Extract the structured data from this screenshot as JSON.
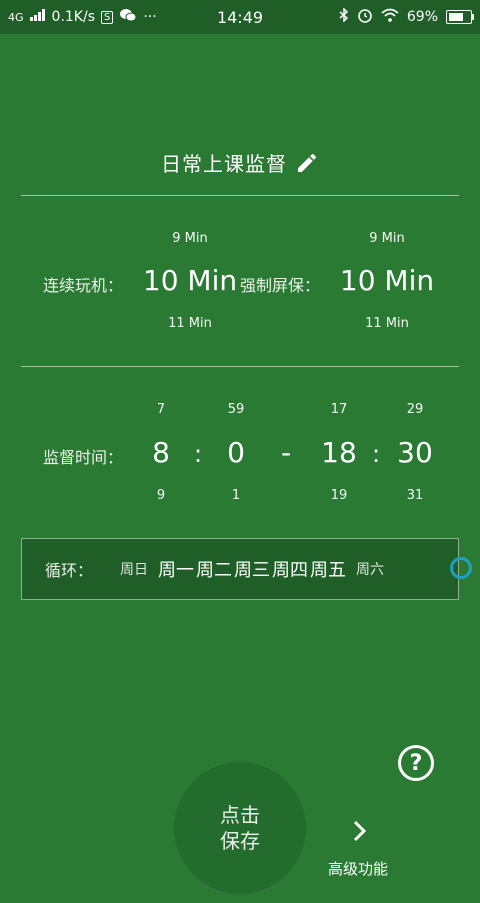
{
  "status_bar": {
    "network": "4G",
    "speed": "0.1K/s",
    "s_badge": "S",
    "wechat_icon": "wechat-icon",
    "more": "···",
    "time": "14:49",
    "battery": "69%",
    "battery_level": 0.69
  },
  "title": "日常上课监督",
  "play_time": {
    "label": "连续玩机：",
    "above": "9 Min",
    "value": "10 Min",
    "below": "11 Min"
  },
  "screensaver": {
    "label": "强制屏保：",
    "above": "9 Min",
    "value": "10 Min",
    "below": "11 Min"
  },
  "supervise_time": {
    "label": "监督时间：",
    "start_hour": {
      "above": "7",
      "value": "8",
      "below": "9"
    },
    "start_min": {
      "above": "59",
      "value": "0",
      "below": "1"
    },
    "end_hour": {
      "above": "17",
      "value": "18",
      "below": "19"
    },
    "end_min": {
      "above": "29",
      "value": "30",
      "below": "31"
    },
    "colon": ":",
    "dash": "-"
  },
  "loop": {
    "label": "循环：",
    "days": [
      {
        "label": "周日",
        "active": false
      },
      {
        "label": "周一",
        "active": true
      },
      {
        "label": "周二",
        "active": true
      },
      {
        "label": "周三",
        "active": true
      },
      {
        "label": "周四",
        "active": true
      },
      {
        "label": "周五",
        "active": true
      },
      {
        "label": "周六",
        "active": false
      }
    ]
  },
  "help_icon": "question-icon",
  "save_button": {
    "line1": "点击",
    "line2": "保存"
  },
  "advanced": {
    "label": "高级功能",
    "icon": "chevron-right-icon"
  },
  "colors": {
    "background": "#2a7a34",
    "dark": "#1f5e27",
    "toggle": "#1f9fc4"
  }
}
